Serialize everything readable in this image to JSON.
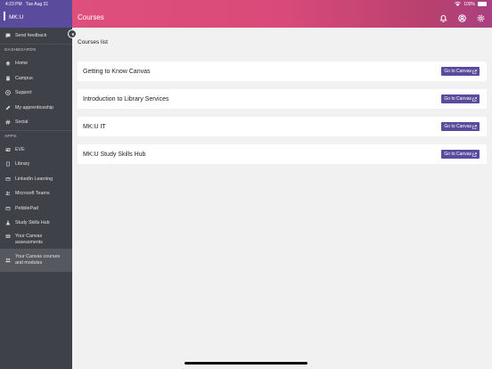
{
  "status_bar": {
    "time": "4:23 PM",
    "date": "Tue Aug 31",
    "battery": "100%"
  },
  "app": {
    "brand": "MK:U",
    "page_title": "Courses"
  },
  "sidebar": {
    "top_items": [
      {
        "label": "Send feedback",
        "icon": "chat-icon"
      }
    ],
    "sections": [
      {
        "title": "DASHBOARDS",
        "items": [
          {
            "label": "Home",
            "icon": "home-icon"
          },
          {
            "label": "Campus",
            "icon": "building-icon"
          },
          {
            "label": "Support",
            "icon": "lifebuoy-icon"
          },
          {
            "label": "My apprenticeship",
            "icon": "pen-icon"
          },
          {
            "label": "Social",
            "icon": "hash-icon"
          }
        ]
      },
      {
        "title": "APPS",
        "items": [
          {
            "label": "EVE",
            "icon": "id-card-icon"
          },
          {
            "label": "Library",
            "icon": "book-icon"
          },
          {
            "label": "LinkedIn Learning",
            "icon": "window-icon"
          },
          {
            "label": "Microsoft Teams",
            "icon": "people-icon"
          },
          {
            "label": "PebblePad",
            "icon": "window-icon"
          },
          {
            "label": "Study Skills Hub",
            "icon": "flask-icon"
          },
          {
            "label": "Your Canvas assessments",
            "icon": "list-icon"
          },
          {
            "label": "Your Canvas courses and modules",
            "icon": "users-icon"
          }
        ]
      }
    ]
  },
  "main": {
    "list_title": "Courses list",
    "courses": [
      {
        "name": "Getting to Know Canvas",
        "action": "Go to Canvas"
      },
      {
        "name": "Introduction to Library Services",
        "action": "Go to Canvas"
      },
      {
        "name": "MK:U IT",
        "action": "Go to Canvas"
      },
      {
        "name": "MK:U Study Skills Hub",
        "action": "Go to Canvas"
      }
    ]
  },
  "colors": {
    "accent": "#5b4b9c",
    "header_gradient_start": "#df4f7c",
    "sidebar_bg": "#3e4147"
  }
}
